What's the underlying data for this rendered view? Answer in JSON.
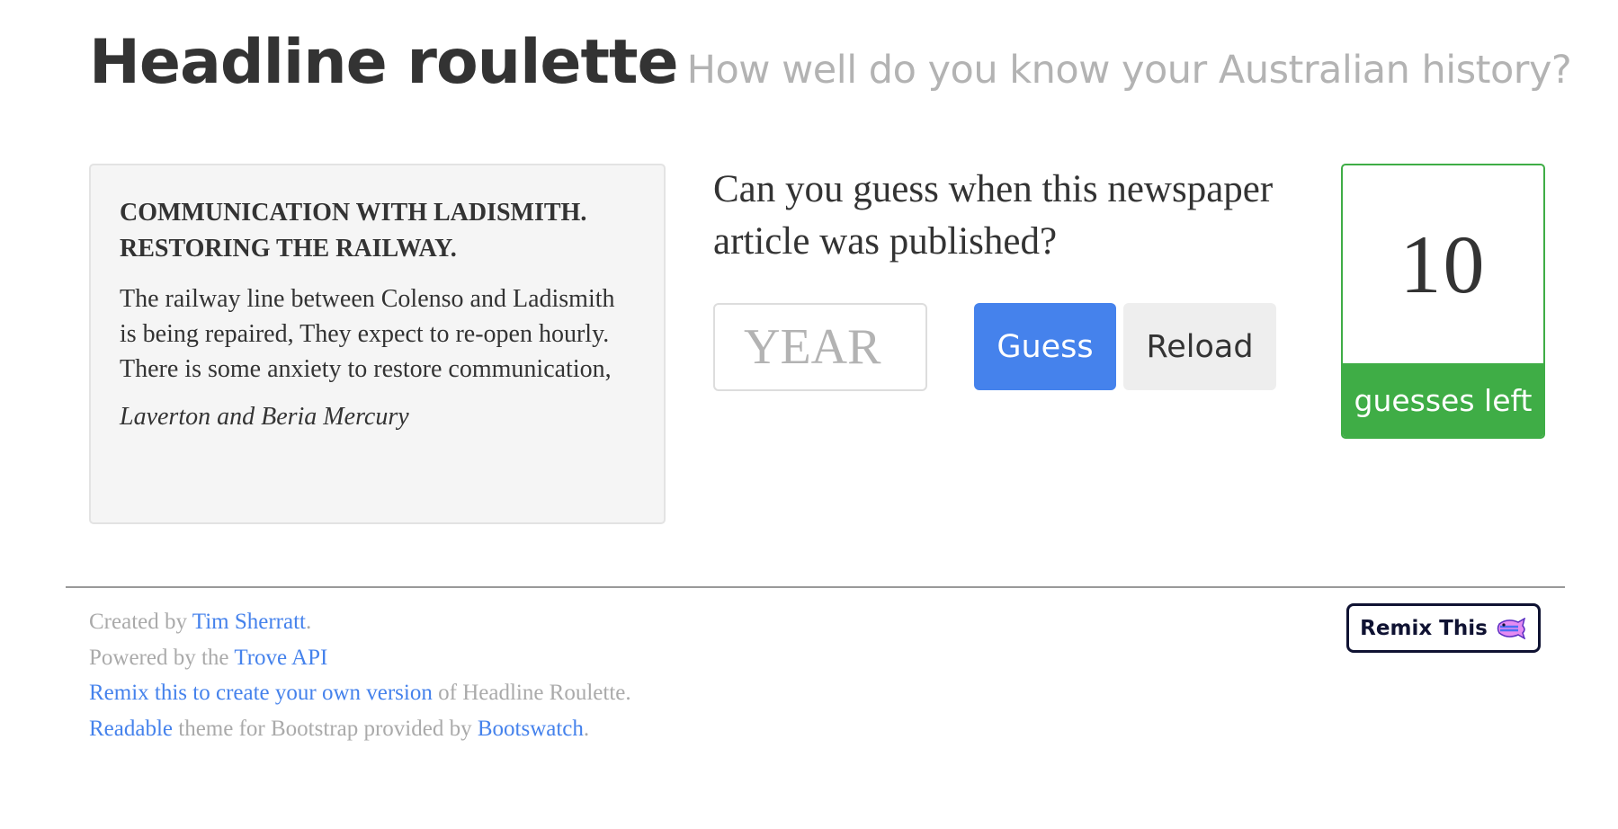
{
  "header": {
    "title": "Headline roulette",
    "subtitle": "How well do you know your Australian history?"
  },
  "article": {
    "title_line1": "COMMUNICATION WITH LADISMITH.",
    "title_line2": "RESTORING THE RAILWAY.",
    "text": "The railway line between Colenso and Ladismith is being repaired, They expect to re-open hourly. There is some anxiety to restore communication,",
    "source": "Laverton and Beria Mercury"
  },
  "game": {
    "question": "Can you guess when this newspaper article was published?",
    "year_placeholder": "YEAR",
    "year_value": "",
    "guess_label": "Guess",
    "reload_label": "Reload",
    "guesses_left_count": "10",
    "guesses_left_label": "guesses left"
  },
  "footer": {
    "line1_prefix": "Created by ",
    "line1_link": "Tim Sherratt",
    "line1_suffix": ".",
    "line2_prefix": "Powered by the ",
    "line2_link": "Trove API",
    "line3_link": "Remix this to create your own version",
    "line3_suffix": " of Headline Roulette.",
    "line4_link1": "Readable",
    "line4_middle": " theme for Bootstrap provided by ",
    "line4_link2": "Bootswatch",
    "line4_suffix": "."
  },
  "remix_button": {
    "label": "Remix This",
    "icon": "glitch-fish-icon"
  },
  "colors": {
    "primary": "#4582ec",
    "success": "#3fad46",
    "muted_text": "#aaaaaa",
    "well_background": "#f5f5f5"
  }
}
